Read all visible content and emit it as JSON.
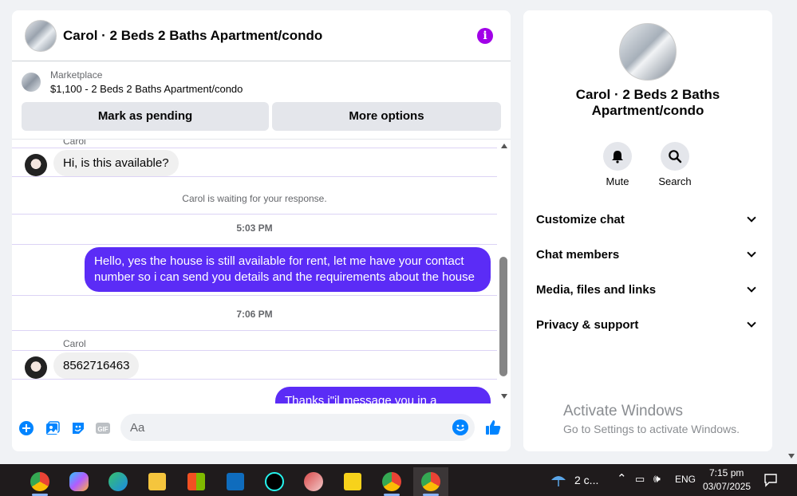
{
  "chat": {
    "title": "Carol · 2 Beds 2 Baths Apartment/condo",
    "marketplace_label": "Marketplace",
    "listing": "$1,100 - 2 Beds 2 Baths Apartment/condo",
    "btn_pending": "Mark as pending",
    "btn_more": "More options",
    "messages": {
      "sender_top": "Carol",
      "msg1": "Hi, is this available?",
      "waiting": "Carol is waiting for your response.",
      "time1": "5:03 PM",
      "reply1_line1": "Hello, yes the house is still available for rent, let me have your contact",
      "reply1_line2": "number so i can send you details and the requirements about the house",
      "time2": "7:06 PM",
      "sender2": "Carol",
      "msg2": "8562716463",
      "reply2": "Thanks i\"il message you in a moment"
    },
    "composer_placeholder": "Aa"
  },
  "info": {
    "title": "Carol · 2 Beds 2 Baths Apartment/condo",
    "mute": "Mute",
    "search": "Search",
    "rows": [
      "Customize chat",
      "Chat members",
      "Media, files and links",
      "Privacy & support"
    ]
  },
  "watermark": {
    "title": "Activate Windows",
    "sub": "Go to Settings to activate Windows."
  },
  "taskbar": {
    "weather": "2 c...",
    "lang": "ENG",
    "time": "7:15 pm",
    "date": "03/07/2025"
  },
  "colors": {
    "accent": "#a100e8",
    "bubble_out": "#5b2cf6",
    "messenger_blue": "#0084ff"
  }
}
